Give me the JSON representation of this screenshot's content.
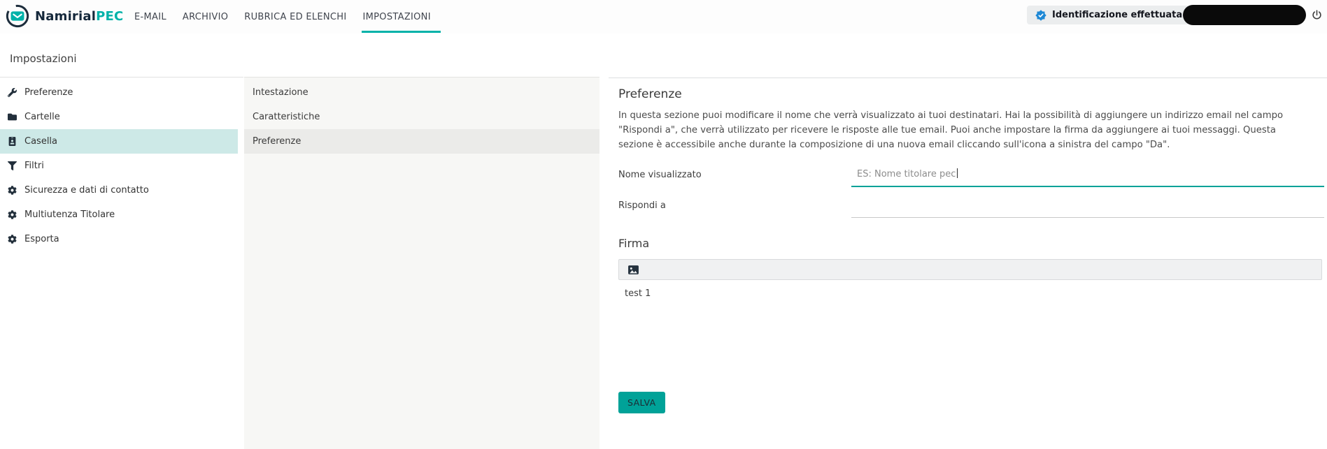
{
  "topbar": {
    "logo": {
      "name": "Namirial",
      "suffix": "PEC"
    },
    "nav": [
      {
        "label": "E-MAIL",
        "active": false
      },
      {
        "label": "ARCHIVIO",
        "active": false
      },
      {
        "label": "RUBRICA ED ELENCHI",
        "active": false
      },
      {
        "label": "IMPOSTAZIONI",
        "active": true
      }
    ],
    "identity_badge": {
      "label": "Identificazione effettuata",
      "icon": "verified-badge-icon"
    },
    "account": {
      "redacted": true
    },
    "power_icon": "power-icon"
  },
  "page": {
    "title": "Impostazioni"
  },
  "sidebar": {
    "items": [
      {
        "label": "Preferenze",
        "icon": "wrench-icon",
        "selected": false
      },
      {
        "label": "Cartelle",
        "icon": "folder-icon",
        "selected": false
      },
      {
        "label": "Casella",
        "icon": "id-badge-icon",
        "selected": true
      },
      {
        "label": "Filtri",
        "icon": "filter-icon",
        "selected": false
      },
      {
        "label": "Sicurezza e dati di contatto",
        "icon": "gear-icon",
        "selected": false
      },
      {
        "label": "Multiutenza Titolare",
        "icon": "gear-icon",
        "selected": false
      },
      {
        "label": "Esporta",
        "icon": "gear-icon",
        "selected": false
      }
    ]
  },
  "submenu": {
    "items": [
      {
        "label": "Intestazione",
        "selected": false
      },
      {
        "label": "Caratteristiche",
        "selected": false
      },
      {
        "label": "Preferenze",
        "selected": true
      }
    ]
  },
  "main": {
    "heading": "Preferenze",
    "description": "In questa sezione puoi modificare il nome che verrà visualizzato ai tuoi destinatari. Hai la possibilità di aggiungere un indirizzo email nel campo \"Rispondi a\", che verrà utilizzato per ricevere le risposte alle tue email. Puoi anche impostare la firma da aggiungere ai tuoi messaggi. Questa sezione è accessibile anche durante la composizione di una nuova email cliccando sull'icona a sinistra del campo \"Da\".",
    "fields": [
      {
        "label": "Nome visualizzato",
        "placeholder": "ES: Nome titolare pec",
        "value": "",
        "focused": true
      },
      {
        "label": "Rispondi a",
        "placeholder": "",
        "value": "",
        "focused": false
      }
    ],
    "signature": {
      "heading": "Firma",
      "toolbar_icons": [
        "image-icon"
      ],
      "content": "test 1"
    },
    "save_label": "SALVA"
  },
  "colors": {
    "accent_teal": "#00b2a9",
    "focus_teal": "#00a298",
    "sidebar_highlight": "#cde9e7",
    "submenu_selected": "#ebebe9",
    "badge_blue": "#1e88d5",
    "redaction_black": "#0a0a0a"
  }
}
